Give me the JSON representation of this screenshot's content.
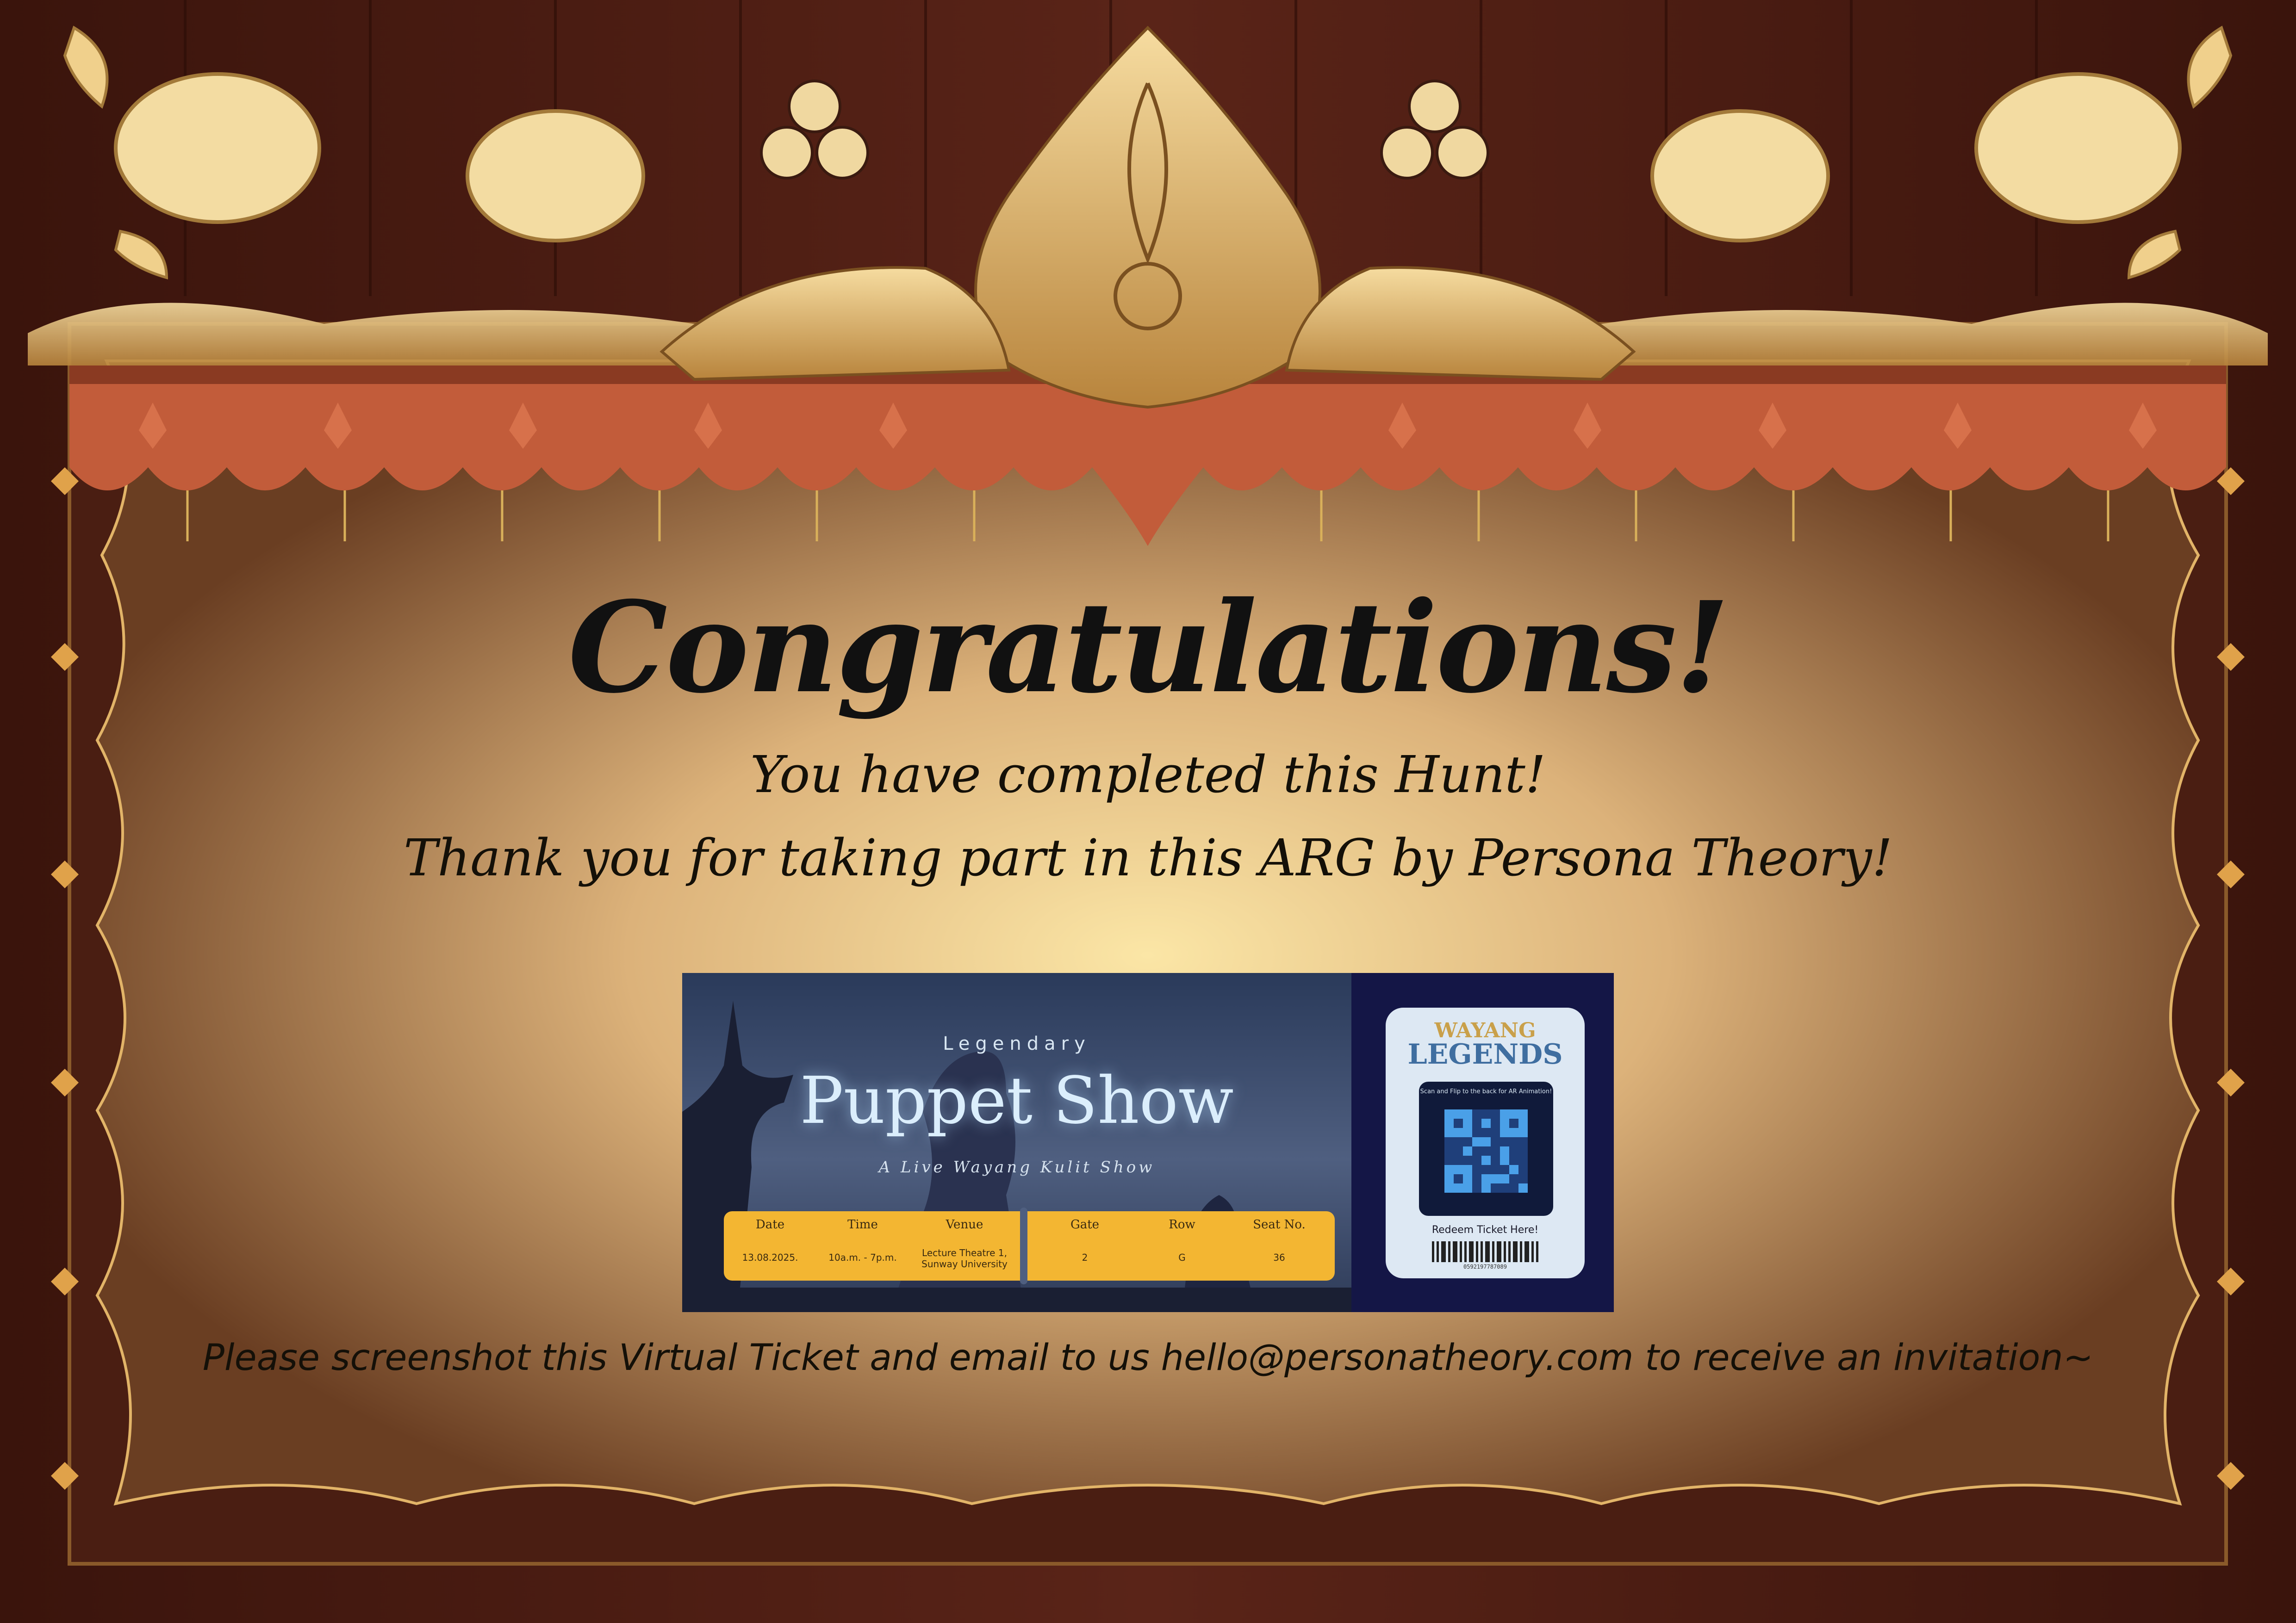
{
  "certificate": {
    "title": "Congratulations!",
    "line1": "You have completed this Hunt!",
    "line2": "Thank you for taking part in this ARG by Persona Theory!",
    "footer": "Please screenshot this Virtual Ticket and email to us hello@personatheory.com to receive an invitation~"
  },
  "ticket": {
    "eyebrow": "Legendary",
    "show_title": "Puppet Show",
    "subtitle": "A Live Wayang Kulit Show",
    "fields": [
      {
        "label": "Date",
        "value": "13.08.2025."
      },
      {
        "label": "Time",
        "value": "10a.m. - 7p.m."
      },
      {
        "label": "Venue",
        "value": "Lecture Theatre 1, Sunway University"
      },
      {
        "label": "Gate",
        "value": "2"
      },
      {
        "label": "Row",
        "value": "G"
      },
      {
        "label": "Seat No.",
        "value": "36"
      }
    ],
    "logo_line1": "WAYANG",
    "logo_line2": "LEGENDS",
    "qr_caption": "Scan and Flip to the back for AR Animation!",
    "redeem_label": "Redeem Ticket Here!",
    "barcode_number": "0592197787089"
  },
  "colors": {
    "frame_dark": "#3a1a10",
    "frame_wood": "#5a2a18",
    "panel_light": "#f2d284",
    "panel_edge": "#7a4a20",
    "awning": "#c25c3a",
    "gold": "#d9b05a",
    "ticket_bar": "#f3b632",
    "ticket_navy": "#141646"
  },
  "icons": [
    "cloud-ornament-icon",
    "flame-ornament-icon",
    "crown-ornament-icon",
    "flower-ornament-icon",
    "spiral-ornament-icon",
    "qr-code-icon",
    "barcode-icon"
  ]
}
